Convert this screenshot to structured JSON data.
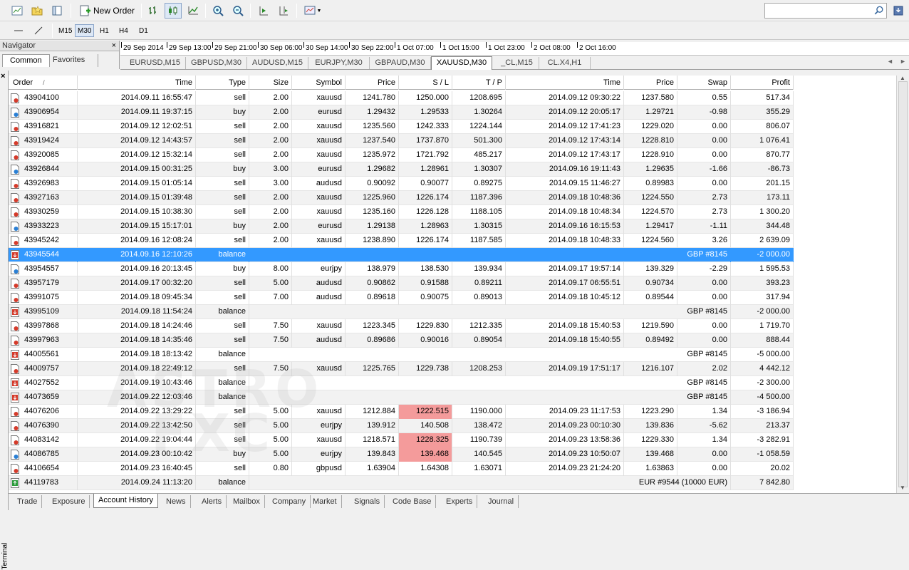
{
  "toolbar": {
    "new_order_label": "New Order",
    "timeframes": [
      "M15",
      "M30",
      "H1",
      "H4",
      "D1"
    ],
    "active_timeframe": "M30",
    "search_placeholder": ""
  },
  "navigator": {
    "title": "Navigator",
    "close": "×",
    "tabs": [
      {
        "label": "Common",
        "active": true
      },
      {
        "label": "Favorites",
        "active": false
      }
    ]
  },
  "timescale": [
    "29 Sep 2014",
    "29 Sep 13:00",
    "29 Sep 21:00",
    "30 Sep 06:00",
    "30 Sep 14:00",
    "30 Sep 22:00",
    "1 Oct 07:00",
    "1 Oct 15:00",
    "1 Oct 23:00",
    "2 Oct 08:00",
    "2 Oct 16:00"
  ],
  "chart_tabs": [
    {
      "label": "EURUSD,M15",
      "active": false
    },
    {
      "label": "GBPUSD,M30",
      "active": false
    },
    {
      "label": "AUDUSD,M15",
      "active": false
    },
    {
      "label": "EURJPY,M30",
      "active": false
    },
    {
      "label": "GBPAUD,M30",
      "active": false
    },
    {
      "label": "XAUUSD,M30",
      "active": true
    },
    {
      "label": "_CL,M15",
      "active": false
    },
    {
      "label": "CL.X4,H1",
      "active": false
    }
  ],
  "terminal": {
    "close": "×",
    "side_label": "Terminal",
    "columns": [
      "Order",
      "Time",
      "Type",
      "Size",
      "Symbol",
      "Price",
      "S / L",
      "T / P",
      "Time",
      "Price",
      "Swap",
      "Profit"
    ],
    "sort_indicator": "/",
    "rows": [
      {
        "order": "43904100",
        "time": "2014.09.11 16:55:47",
        "type": "sell",
        "size": "2.00",
        "symbol": "xauusd",
        "price": "1241.780",
        "sl": "1250.000",
        "tp": "1208.695",
        "ctime": "2014.09.12 09:30:22",
        "cprice": "1237.580",
        "swap": "0.55",
        "profit": "517.34"
      },
      {
        "order": "43906954",
        "time": "2014.09.11 19:37:15",
        "type": "buy",
        "size": "2.00",
        "symbol": "eurusd",
        "price": "1.29432",
        "sl": "1.29533",
        "tp": "1.30264",
        "ctime": "2014.09.12 20:05:17",
        "cprice": "1.29721",
        "swap": "-0.98",
        "profit": "355.29"
      },
      {
        "order": "43916821",
        "time": "2014.09.12 12:02:51",
        "type": "sell",
        "size": "2.00",
        "symbol": "xauusd",
        "price": "1235.560",
        "sl": "1242.333",
        "tp": "1224.144",
        "ctime": "2014.09.12 17:41:23",
        "cprice": "1229.020",
        "swap": "0.00",
        "profit": "806.07"
      },
      {
        "order": "43919424",
        "time": "2014.09.12 14:43:57",
        "type": "sell",
        "size": "2.00",
        "symbol": "xauusd",
        "price": "1237.540",
        "sl": "1737.870",
        "tp": "501.300",
        "ctime": "2014.09.12 17:43:14",
        "cprice": "1228.810",
        "swap": "0.00",
        "profit": "1 076.41"
      },
      {
        "order": "43920085",
        "time": "2014.09.12 15:32:14",
        "type": "sell",
        "size": "2.00",
        "symbol": "xauusd",
        "price": "1235.972",
        "sl": "1721.792",
        "tp": "485.217",
        "ctime": "2014.09.12 17:43:17",
        "cprice": "1228.910",
        "swap": "0.00",
        "profit": "870.77"
      },
      {
        "order": "43926844",
        "time": "2014.09.15 00:31:25",
        "type": "buy",
        "size": "3.00",
        "symbol": "eurusd",
        "price": "1.29682",
        "sl": "1.28961",
        "tp": "1.30307",
        "ctime": "2014.09.16 19:11:43",
        "cprice": "1.29635",
        "swap": "-1.66",
        "profit": "-86.73"
      },
      {
        "order": "43926983",
        "time": "2014.09.15 01:05:14",
        "type": "sell",
        "size": "3.00",
        "symbol": "audusd",
        "price": "0.90092",
        "sl": "0.90077",
        "tp": "0.89275",
        "ctime": "2014.09.15 11:46:27",
        "cprice": "0.89983",
        "swap": "0.00",
        "profit": "201.15"
      },
      {
        "order": "43927163",
        "time": "2014.09.15 01:39:48",
        "type": "sell",
        "size": "2.00",
        "symbol": "xauusd",
        "price": "1225.960",
        "sl": "1226.174",
        "tp": "1187.396",
        "ctime": "2014.09.18 10:48:36",
        "cprice": "1224.550",
        "swap": "2.73",
        "profit": "173.11"
      },
      {
        "order": "43930259",
        "time": "2014.09.15 10:38:30",
        "type": "sell",
        "size": "2.00",
        "symbol": "xauusd",
        "price": "1235.160",
        "sl": "1226.128",
        "tp": "1188.105",
        "ctime": "2014.09.18 10:48:34",
        "cprice": "1224.570",
        "swap": "2.73",
        "profit": "1 300.20"
      },
      {
        "order": "43933223",
        "time": "2014.09.15 15:17:01",
        "type": "buy",
        "size": "2.00",
        "symbol": "eurusd",
        "price": "1.29138",
        "sl": "1.28963",
        "tp": "1.30315",
        "ctime": "2014.09.16 16:15:53",
        "cprice": "1.29417",
        "swap": "-1.11",
        "profit": "344.48"
      },
      {
        "order": "43945242",
        "time": "2014.09.16 12:08:24",
        "type": "sell",
        "size": "2.00",
        "symbol": "xauusd",
        "price": "1238.890",
        "sl": "1226.174",
        "tp": "1187.585",
        "ctime": "2014.09.18 10:48:33",
        "cprice": "1224.560",
        "swap": "3.26",
        "profit": "2 639.09"
      },
      {
        "order": "43945544",
        "time": "2014.09.16 12:10:26",
        "type": "balance",
        "comment": "GBP #8145",
        "profit": "-2 000.00",
        "selected": true
      },
      {
        "order": "43954557",
        "time": "2014.09.16 20:13:45",
        "type": "buy",
        "size": "8.00",
        "symbol": "eurjpy",
        "price": "138.979",
        "sl": "138.530",
        "tp": "139.934",
        "ctime": "2014.09.17 19:57:14",
        "cprice": "139.329",
        "swap": "-2.29",
        "profit": "1 595.53"
      },
      {
        "order": "43957179",
        "time": "2014.09.17 00:32:20",
        "type": "sell",
        "size": "5.00",
        "symbol": "audusd",
        "price": "0.90862",
        "sl": "0.91588",
        "tp": "0.89211",
        "ctime": "2014.09.17 06:55:51",
        "cprice": "0.90734",
        "swap": "0.00",
        "profit": "393.23"
      },
      {
        "order": "43991075",
        "time": "2014.09.18 09:45:34",
        "type": "sell",
        "size": "7.00",
        "symbol": "audusd",
        "price": "0.89618",
        "sl": "0.90075",
        "tp": "0.89013",
        "ctime": "2014.09.18 10:45:12",
        "cprice": "0.89544",
        "swap": "0.00",
        "profit": "317.94"
      },
      {
        "order": "43995109",
        "time": "2014.09.18 11:54:24",
        "type": "balance",
        "comment": "GBP #8145",
        "profit": "-2 000.00"
      },
      {
        "order": "43997868",
        "time": "2014.09.18 14:24:46",
        "type": "sell",
        "size": "7.50",
        "symbol": "xauusd",
        "price": "1223.345",
        "sl": "1229.830",
        "tp": "1212.335",
        "ctime": "2014.09.18 15:40:53",
        "cprice": "1219.590",
        "swap": "0.00",
        "profit": "1 719.70"
      },
      {
        "order": "43997963",
        "time": "2014.09.18 14:35:46",
        "type": "sell",
        "size": "7.50",
        "symbol": "audusd",
        "price": "0.89686",
        "sl": "0.90016",
        "tp": "0.89054",
        "ctime": "2014.09.18 15:40:55",
        "cprice": "0.89492",
        "swap": "0.00",
        "profit": "888.44"
      },
      {
        "order": "44005561",
        "time": "2014.09.18 18:13:42",
        "type": "balance",
        "comment": "GBP #8145",
        "profit": "-5 000.00"
      },
      {
        "order": "44009757",
        "time": "2014.09.18 22:49:12",
        "type": "sell",
        "size": "7.50",
        "symbol": "xauusd",
        "price": "1225.765",
        "sl": "1229.738",
        "tp": "1208.253",
        "ctime": "2014.09.19 17:51:17",
        "cprice": "1216.107",
        "swap": "2.02",
        "profit": "4 442.12"
      },
      {
        "order": "44027552",
        "time": "2014.09.19 10:43:46",
        "type": "balance",
        "comment": "GBP #8145",
        "profit": "-2 300.00"
      },
      {
        "order": "44073659",
        "time": "2014.09.22 12:03:46",
        "type": "balance",
        "comment": "GBP #8145",
        "profit": "-4 500.00"
      },
      {
        "order": "44076206",
        "time": "2014.09.22 13:29:22",
        "type": "sell",
        "size": "5.00",
        "symbol": "xauusd",
        "price": "1212.884",
        "sl": "1222.515",
        "tp": "1190.000",
        "ctime": "2014.09.23 11:17:53",
        "cprice": "1223.290",
        "swap": "1.34",
        "profit": "-3 186.94",
        "sl_hit": true
      },
      {
        "order": "44076390",
        "time": "2014.09.22 13:42:50",
        "type": "sell",
        "size": "5.00",
        "symbol": "eurjpy",
        "price": "139.912",
        "sl": "140.508",
        "tp": "138.472",
        "ctime": "2014.09.23 00:10:30",
        "cprice": "139.836",
        "swap": "-5.62",
        "profit": "213.37"
      },
      {
        "order": "44083142",
        "time": "2014.09.22 19:04:44",
        "type": "sell",
        "size": "5.00",
        "symbol": "xauusd",
        "price": "1218.571",
        "sl": "1228.325",
        "tp": "1190.739",
        "ctime": "2014.09.23 13:58:36",
        "cprice": "1229.330",
        "swap": "1.34",
        "profit": "-3 282.91",
        "sl_hit": true
      },
      {
        "order": "44086785",
        "time": "2014.09.23 00:10:42",
        "type": "buy",
        "size": "5.00",
        "symbol": "eurjpy",
        "price": "139.843",
        "sl": "139.468",
        "tp": "140.545",
        "ctime": "2014.09.23 10:50:07",
        "cprice": "139.468",
        "swap": "0.00",
        "profit": "-1 058.59",
        "sl_hit": true
      },
      {
        "order": "44106654",
        "time": "2014.09.23 16:40:45",
        "type": "sell",
        "size": "0.80",
        "symbol": "gbpusd",
        "price": "1.63904",
        "sl": "1.64308",
        "tp": "1.63071",
        "ctime": "2014.09.23 21:24:20",
        "cprice": "1.63863",
        "swap": "0.00",
        "profit": "20.02"
      },
      {
        "order": "44119783",
        "time": "2014.09.24 11:13:20",
        "type": "balance",
        "comment": "EUR #9544 (10000 EUR)",
        "profit": "7 842.80",
        "deposit": true
      }
    ]
  },
  "bottom_tabs": [
    {
      "label": "Trade",
      "active": false
    },
    {
      "label": "Exposure",
      "active": false
    },
    {
      "label": "Account History",
      "active": true
    },
    {
      "label": "News",
      "active": false
    },
    {
      "label": "Alerts",
      "active": false
    },
    {
      "label": "Mailbox",
      "active": false
    },
    {
      "label": "Company",
      "active": false
    },
    {
      "label": "Market",
      "active": false
    },
    {
      "label": "Signals",
      "active": false
    },
    {
      "label": "Code Base",
      "active": false
    },
    {
      "label": "Experts",
      "active": false
    },
    {
      "label": "Journal",
      "active": false
    }
  ],
  "colors": {
    "selection": "#3399ff",
    "sl_hit": "#f49b9b",
    "buy_icon": "#2a7fd4",
    "sell_icon": "#d43a2a",
    "deposit_icon": "#2a9a3a"
  }
}
